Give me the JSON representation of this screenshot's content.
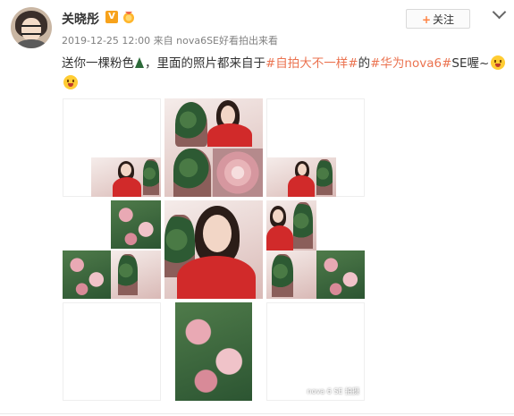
{
  "user": {
    "name": "关晓彤",
    "verified_badge": "V"
  },
  "post": {
    "date": "2019-12-25 12:00",
    "source_prefix": "来自",
    "source": "nova6SE好看拍出来看",
    "text_part1": "送你一棵粉色",
    "text_part2": "，里面的照片都来自于",
    "hashtag1": "#自拍大不一样#",
    "text_part3": "的",
    "hashtag2": "#华为nova6#",
    "text_part4": "SE喔~"
  },
  "actions": {
    "follow_label": "关注",
    "follow_plus": "+"
  },
  "images": {
    "watermark": "nova 6 SE 拍摄"
  },
  "icons": [
    "avatar",
    "verified-icon",
    "medal-icon",
    "christmas-tree-emoji",
    "smile-emoji",
    "chevron-down-icon"
  ],
  "colors": {
    "link": "#eb7350",
    "meta": "#808080",
    "badge": "#f7a21b",
    "follow_plus": "#ff8140"
  }
}
